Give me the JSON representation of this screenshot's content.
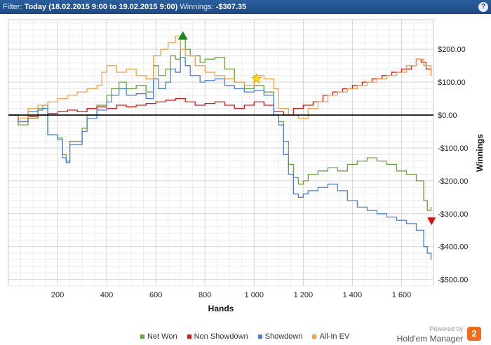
{
  "header": {
    "filter_label": "Filter:",
    "filter_value": "Today (18.02.2015 9:00 to 19.02.2015 9:00)",
    "winnings_label": "Winnings:",
    "winnings_value": "-$307.35",
    "help_glyph": "?"
  },
  "brand": {
    "powered_by": "Powered by",
    "name": "Hold'em Manager",
    "logo_text": "2"
  },
  "chart_data": {
    "type": "line",
    "xlabel": "Hands",
    "ylabel": "Winnings",
    "xlim": [
      0,
      1730
    ],
    "ylim": [
      -520,
      290
    ],
    "x_ticks": [
      200,
      400,
      600,
      800,
      1000,
      1200,
      1400,
      1600
    ],
    "x_tick_labels": [
      "200",
      "400",
      "600",
      "800",
      "1 000",
      "1 200",
      "1 400",
      "1 600"
    ],
    "y_ticks": [
      200,
      100,
      0,
      -100,
      -200,
      -300,
      -400,
      -500
    ],
    "y_tick_labels": [
      "$200.00",
      "$100.00",
      "$0.00",
      "-$100.00",
      "-$200.00",
      "-$300.00",
      "-$400.00",
      "-$500.00"
    ],
    "grid": true,
    "legend_position": "bottom",
    "series": [
      {
        "name": "Net Won",
        "color": "#6aa43a",
        "x": [
          0,
          40,
          80,
          120,
          140,
          160,
          200,
          220,
          235,
          250,
          300,
          320,
          360,
          400,
          420,
          450,
          480,
          520,
          560,
          590,
          610,
          640,
          660,
          680,
          700,
          720,
          740,
          780,
          800,
          840,
          880,
          920,
          960,
          1000,
          1040,
          1080,
          1100,
          1120,
          1140,
          1160,
          1180,
          1200,
          1220,
          1260,
          1300,
          1340,
          1380,
          1420,
          1460,
          1500,
          1540,
          1580,
          1620,
          1660,
          1690,
          1705,
          1720
        ],
        "y": [
          0,
          -30,
          -10,
          20,
          30,
          -60,
          -70,
          -120,
          -140,
          -80,
          -40,
          0,
          30,
          60,
          80,
          100,
          80,
          90,
          70,
          150,
          120,
          140,
          180,
          170,
          230,
          200,
          180,
          160,
          170,
          175,
          140,
          100,
          80,
          90,
          70,
          0,
          -20,
          -80,
          -150,
          -190,
          -210,
          -200,
          -180,
          -170,
          -160,
          -170,
          -150,
          -140,
          -130,
          -140,
          -150,
          -170,
          -180,
          -200,
          -260,
          -290,
          -280
        ]
      },
      {
        "name": "Non Showdown",
        "color": "#e01818",
        "x": [
          0,
          40,
          80,
          120,
          160,
          200,
          240,
          280,
          320,
          360,
          400,
          440,
          480,
          520,
          560,
          600,
          640,
          680,
          720,
          760,
          800,
          840,
          880,
          920,
          960,
          1000,
          1040,
          1080,
          1120,
          1160,
          1200,
          1240,
          1280,
          1320,
          1360,
          1400,
          1440,
          1480,
          1520,
          1560,
          1600,
          1640,
          1660,
          1680,
          1700,
          1720
        ],
        "y": [
          0,
          -20,
          -5,
          0,
          5,
          10,
          15,
          10,
          20,
          25,
          20,
          30,
          25,
          30,
          35,
          40,
          45,
          50,
          40,
          30,
          35,
          40,
          30,
          20,
          30,
          40,
          30,
          10,
          0,
          20,
          30,
          40,
          60,
          70,
          80,
          90,
          100,
          110,
          120,
          130,
          140,
          150,
          170,
          160,
          140,
          120
        ]
      },
      {
        "name": "Showdown",
        "color": "#4a7fe0",
        "x": [
          0,
          40,
          80,
          120,
          140,
          160,
          200,
          220,
          235,
          250,
          300,
          320,
          360,
          400,
          420,
          450,
          480,
          520,
          560,
          590,
          610,
          640,
          660,
          680,
          700,
          720,
          740,
          780,
          800,
          840,
          880,
          920,
          960,
          1000,
          1040,
          1080,
          1100,
          1120,
          1140,
          1160,
          1180,
          1200,
          1220,
          1260,
          1300,
          1340,
          1380,
          1420,
          1460,
          1500,
          1540,
          1580,
          1620,
          1660,
          1690,
          1705,
          1720
        ],
        "y": [
          0,
          -20,
          10,
          15,
          20,
          -60,
          -75,
          -130,
          -145,
          -90,
          -50,
          -10,
          15,
          40,
          60,
          80,
          60,
          65,
          50,
          110,
          80,
          100,
          140,
          130,
          175,
          150,
          120,
          100,
          105,
          110,
          90,
          80,
          70,
          75,
          60,
          0,
          -30,
          -120,
          -180,
          -240,
          -250,
          -240,
          -230,
          -220,
          -210,
          -230,
          -260,
          -280,
          -290,
          -300,
          -310,
          -320,
          -330,
          -350,
          -400,
          -420,
          -440
        ]
      },
      {
        "name": "All-In EV",
        "color": "#f5a04a",
        "x": [
          0,
          40,
          80,
          120,
          160,
          200,
          240,
          280,
          320,
          360,
          380,
          400,
          440,
          480,
          520,
          560,
          590,
          620,
          650,
          680,
          700,
          720,
          760,
          800,
          840,
          880,
          920,
          960,
          1000,
          1040,
          1080,
          1100,
          1140,
          1180,
          1220,
          1260,
          1300,
          1340,
          1380,
          1420,
          1460,
          1500,
          1540,
          1580,
          1620,
          1660,
          1690,
          1720
        ],
        "y": [
          0,
          -10,
          20,
          30,
          40,
          50,
          60,
          70,
          80,
          90,
          130,
          150,
          130,
          140,
          120,
          110,
          180,
          200,
          220,
          240,
          200,
          180,
          150,
          130,
          120,
          110,
          100,
          90,
          120,
          110,
          80,
          20,
          0,
          -10,
          20,
          40,
          60,
          70,
          80,
          90,
          100,
          110,
          120,
          130,
          150,
          170,
          150,
          120
        ]
      }
    ],
    "markers": [
      {
        "kind": "triangle-up",
        "x": 710,
        "y": 240,
        "color": "#1a8a1a"
      },
      {
        "kind": "star",
        "x": 1010,
        "y": 110,
        "color": "#ffe000"
      },
      {
        "kind": "triangle-down",
        "x": 1722,
        "y": -322,
        "color": "#d01010"
      }
    ]
  }
}
